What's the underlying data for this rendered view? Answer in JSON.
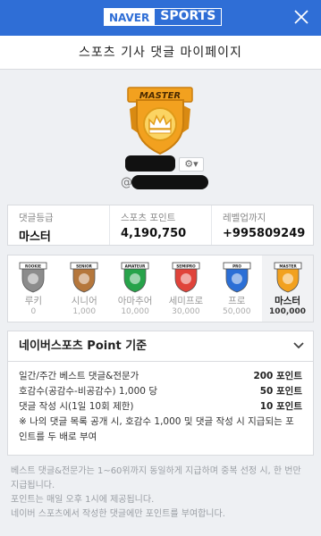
{
  "header": {
    "logo_naver": "NAVER",
    "logo_sports": "SPORTS",
    "close_label": "닫기"
  },
  "title": "스포츠 기사 댓글 마이페이지",
  "badge": {
    "label": "MASTER",
    "color": "#f2a11f"
  },
  "profile": {
    "at_symbol": "@"
  },
  "stats": [
    {
      "label": "댓글등급",
      "value": "마스터"
    },
    {
      "label": "스포츠 포인트",
      "value": "4,190,750"
    },
    {
      "label": "레벨업까지",
      "value": "+995809249"
    }
  ],
  "levels": [
    {
      "badge_text": "ROOKIE",
      "name": "루키",
      "points": "0",
      "color": "#8c8c8c",
      "active": false
    },
    {
      "badge_text": "SENIOR",
      "name": "시니어",
      "points": "1,000",
      "color": "#b5773c",
      "active": false
    },
    {
      "badge_text": "AMATEUR",
      "name": "아마추어",
      "points": "10,000",
      "color": "#27a34a",
      "active": false
    },
    {
      "badge_text": "SEMIPRO",
      "name": "세미프로",
      "points": "30,000",
      "color": "#e0433a",
      "active": false
    },
    {
      "badge_text": "PRO",
      "name": "프로",
      "points": "50,000",
      "color": "#2b6fd6",
      "active": false
    },
    {
      "badge_text": "MASTER",
      "name": "마스터",
      "points": "100,000",
      "color": "#f2a11f",
      "active": true
    }
  ],
  "point_section": {
    "title": "네이버스포츠 Point 기준",
    "rows": [
      {
        "label": "일간/주간 베스트 댓글&전문가",
        "value": "200 포인트"
      },
      {
        "label": "호감수(공감수-비공감수) 1,000 당",
        "value": "50 포인트"
      },
      {
        "label": "댓글 작성 시(1일 10회 제한)",
        "value": "10 포인트"
      }
    ],
    "note": "※ 나의 댓글 목록 공개 시, 호감수 1,000 및 댓글 작성 시 지급되는 포인트를 두 배로 부여"
  },
  "footnotes": [
    "베스트 댓글&전문가는 1~60위까지 동일하게 지급하며 중복 선정 시, 한 번만 지급됩니다.",
    "포인트는 매일 오후 1시에 제공됩니다.",
    "네이버 스포츠에서 작성한 댓글에만 포인트를 부여합니다."
  ]
}
